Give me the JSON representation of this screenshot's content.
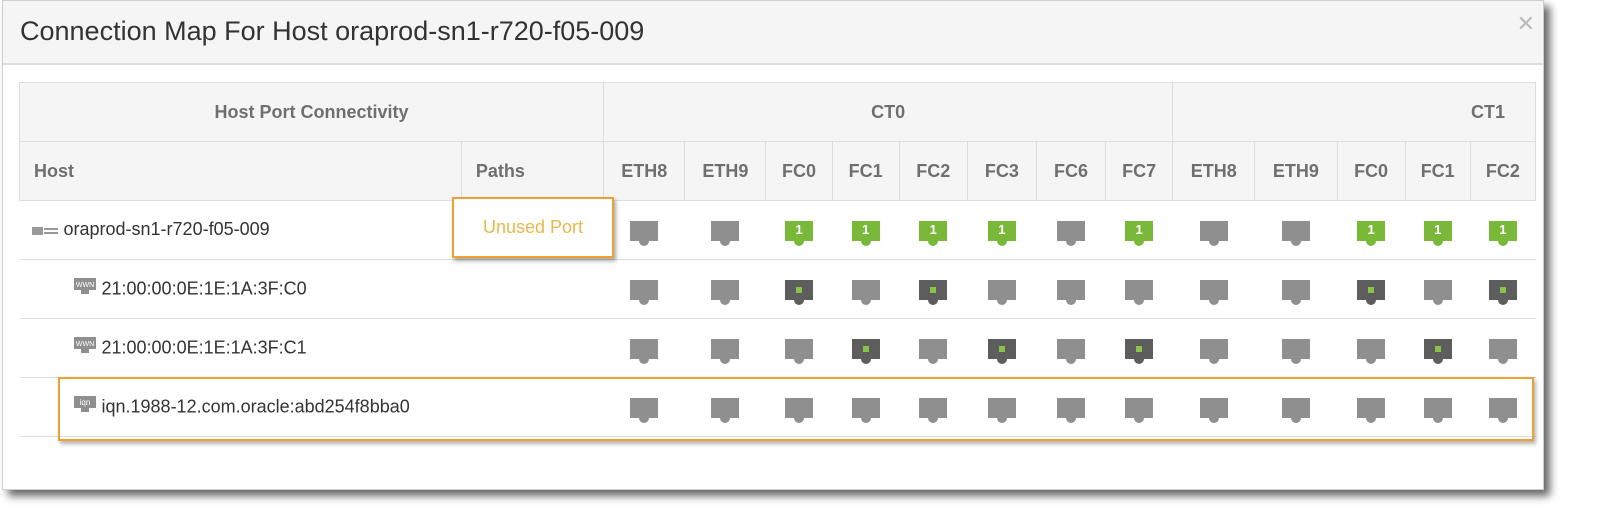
{
  "dialog": {
    "title": "Connection Map For Host oraprod-sn1-r720-f05-009",
    "close_icon": "close-icon"
  },
  "table": {
    "group_header": "Host Port Connectivity",
    "host_header": "Host",
    "paths_header": "Paths",
    "controllers": [
      {
        "name": "CT0",
        "ports": [
          "ETH8",
          "ETH9",
          "FC0",
          "FC1",
          "FC2",
          "FC3",
          "FC6",
          "FC7"
        ]
      },
      {
        "name": "CT1",
        "ports": [
          "ETH8",
          "ETH9",
          "FC0",
          "FC1",
          "FC2"
        ]
      }
    ],
    "rows": [
      {
        "name": "oraprod-sn1-r720-f05-009",
        "icon": "host-icon",
        "paths": "Unused Port",
        "level": 0,
        "states": [
          "unused",
          "unused",
          "used",
          "used",
          "used",
          "used",
          "unused",
          "used",
          "unused",
          "unused",
          "used",
          "used",
          "used"
        ],
        "count": "1"
      },
      {
        "name": "21:00:00:0E:1E:1A:3F:C0",
        "icon": "wwn-icon",
        "paths": "",
        "level": 1,
        "states": [
          "unused",
          "unused",
          "conn",
          "unused",
          "conn",
          "unused",
          "unused",
          "unused",
          "unused",
          "unused",
          "conn",
          "unused",
          "conn"
        ]
      },
      {
        "name": "21:00:00:0E:1E:1A:3F:C1",
        "icon": "wwn-icon",
        "paths": "",
        "level": 1,
        "states": [
          "unused",
          "unused",
          "unused",
          "conn",
          "unused",
          "conn",
          "unused",
          "conn",
          "unused",
          "unused",
          "unused",
          "conn",
          "unused"
        ]
      },
      {
        "name": "iqn.1988-12.com.oracle:abd254f8bba0",
        "icon": "iqn-icon",
        "paths": "",
        "level": 1,
        "states": [
          "unused",
          "unused",
          "unused",
          "unused",
          "unused",
          "unused",
          "unused",
          "unused",
          "unused",
          "unused",
          "unused",
          "unused",
          "unused"
        ]
      }
    ]
  },
  "colors": {
    "used": "#7ab83a",
    "highlight": "#f0a030",
    "unused_text": "#e8b84a"
  }
}
